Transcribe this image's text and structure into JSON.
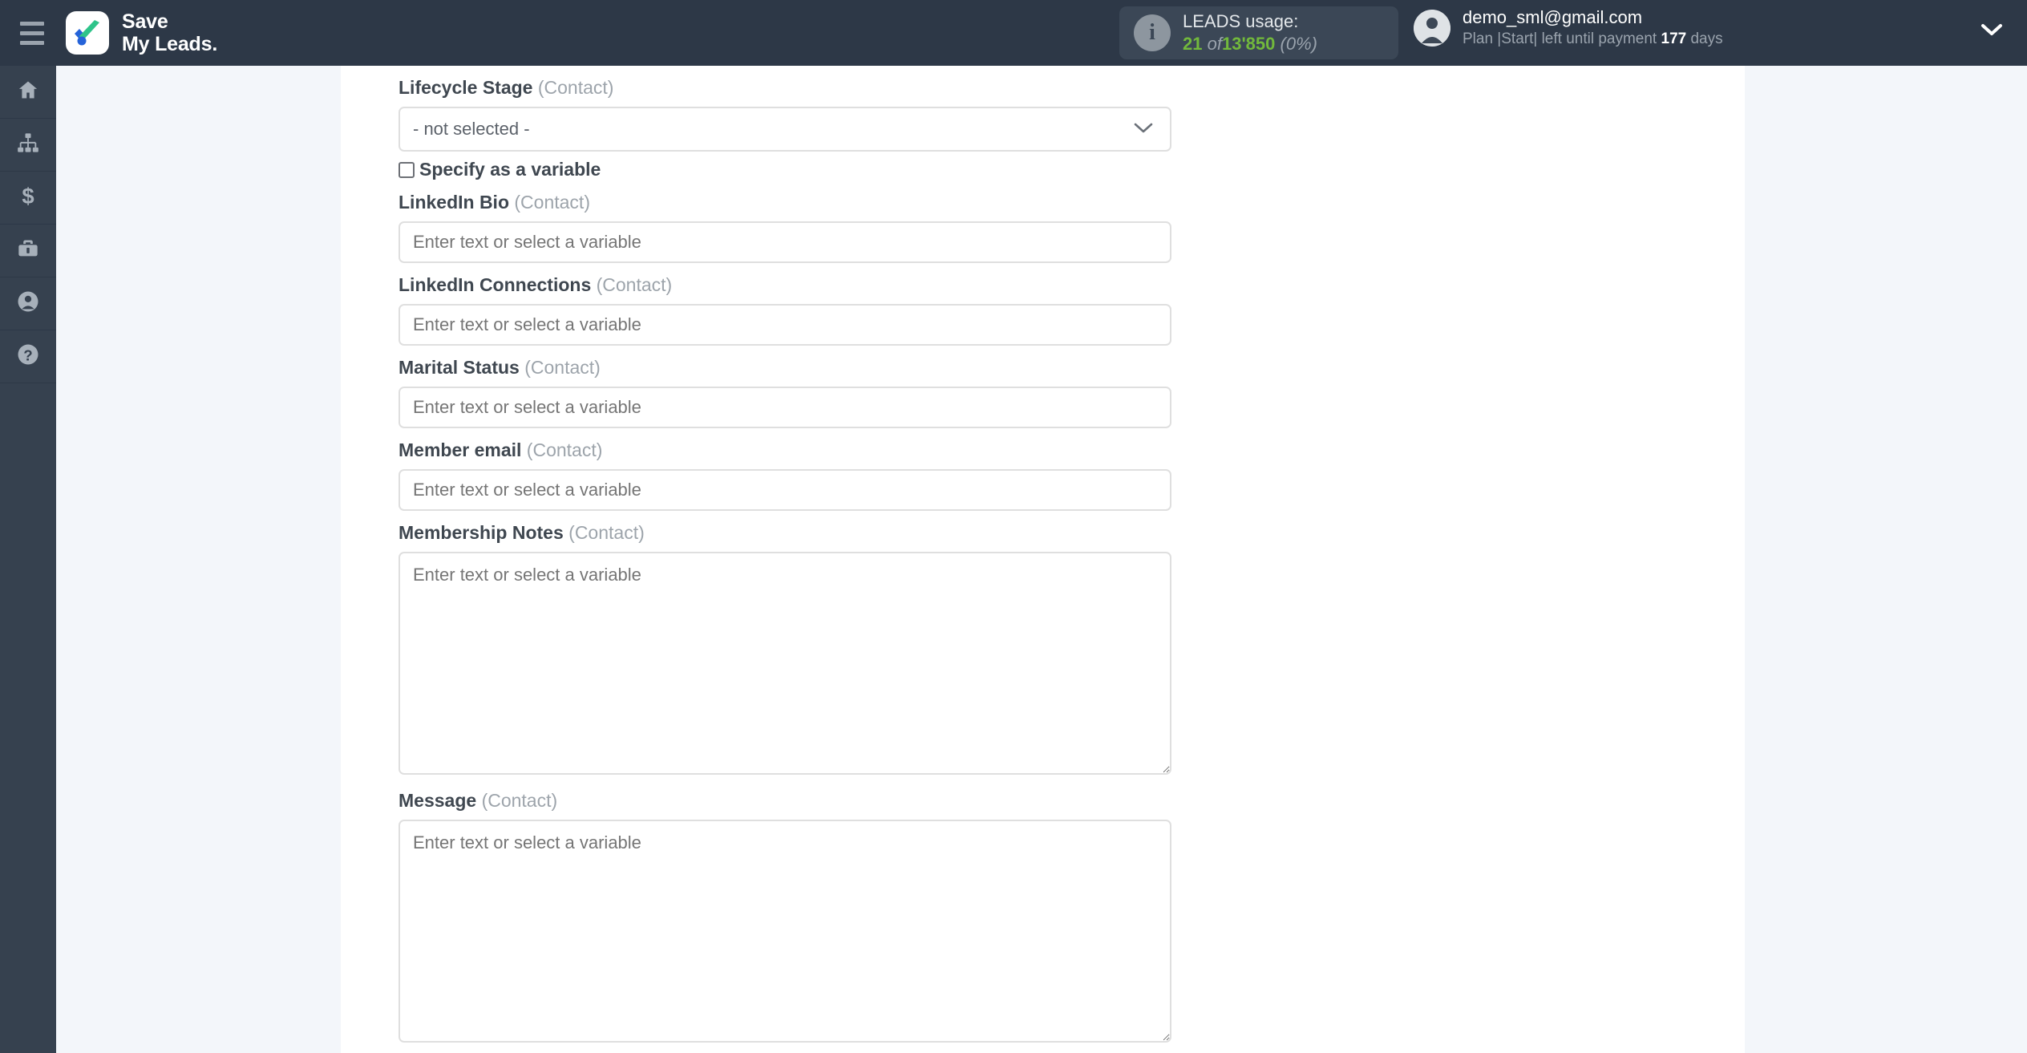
{
  "header": {
    "menu_icon": "hamburger-menu-icon",
    "brand_line1": "Save",
    "brand_line2": "My Leads.",
    "logo_icon": "checkmark-logo-icon",
    "usage": {
      "info_icon": "info-icon",
      "title": "LEADS usage:",
      "used": "21",
      "of": "of",
      "total": "13'850",
      "percent": "(0%)"
    },
    "user": {
      "avatar_icon": "user-avatar-icon",
      "email": "demo_sml@gmail.com",
      "plan_prefix": "Plan |Start| left until payment",
      "days_value": "177",
      "days_suffix": "days",
      "caret_icon": "chevron-down-icon"
    }
  },
  "sidebar": {
    "items": [
      {
        "name": "home",
        "icon": "home-icon"
      },
      {
        "name": "connections",
        "icon": "sitemap-icon"
      },
      {
        "name": "billing",
        "icon": "dollar-icon"
      },
      {
        "name": "business",
        "icon": "briefcase-icon"
      },
      {
        "name": "account",
        "icon": "user-circle-icon"
      },
      {
        "name": "help",
        "icon": "question-circle-icon"
      }
    ]
  },
  "form": {
    "context_suffix": "(Contact)",
    "text_placeholder": "Enter text or select a variable",
    "checkbox_label": "Specify as a variable",
    "select_caret_icon": "chevron-down-icon",
    "fields": [
      {
        "label": "Lifecycle Stage",
        "context": "(Contact)",
        "type": "select",
        "value": "- not selected -",
        "has_checkbox": true,
        "checkbox_label": "Specify as a variable",
        "checked": false
      },
      {
        "label": "LinkedIn Bio",
        "context": "(Contact)",
        "type": "input",
        "value": "",
        "placeholder": "Enter text or select a variable"
      },
      {
        "label": "LinkedIn Connections",
        "context": "(Contact)",
        "type": "input",
        "value": "",
        "placeholder": "Enter text or select a variable"
      },
      {
        "label": "Marital Status",
        "context": "(Contact)",
        "type": "input",
        "value": "",
        "placeholder": "Enter text or select a variable"
      },
      {
        "label": "Member email",
        "context": "(Contact)",
        "type": "input",
        "value": "",
        "placeholder": "Enter text or select a variable"
      },
      {
        "label": "Membership Notes",
        "context": "(Contact)",
        "type": "textarea",
        "value": "",
        "placeholder": "Enter text or select a variable"
      },
      {
        "label": "Message",
        "context": "(Contact)",
        "type": "textarea",
        "value": "",
        "placeholder": "Enter text or select a variable"
      }
    ]
  },
  "colors": {
    "topbar": "#2d3847",
    "sidebar": "#36414f",
    "backdrop": "#f3f6fa",
    "panel": "#ffffff",
    "accent_green": "#72b93c",
    "logo_green": "#2ec48a",
    "logo_blue": "#2563d9"
  }
}
